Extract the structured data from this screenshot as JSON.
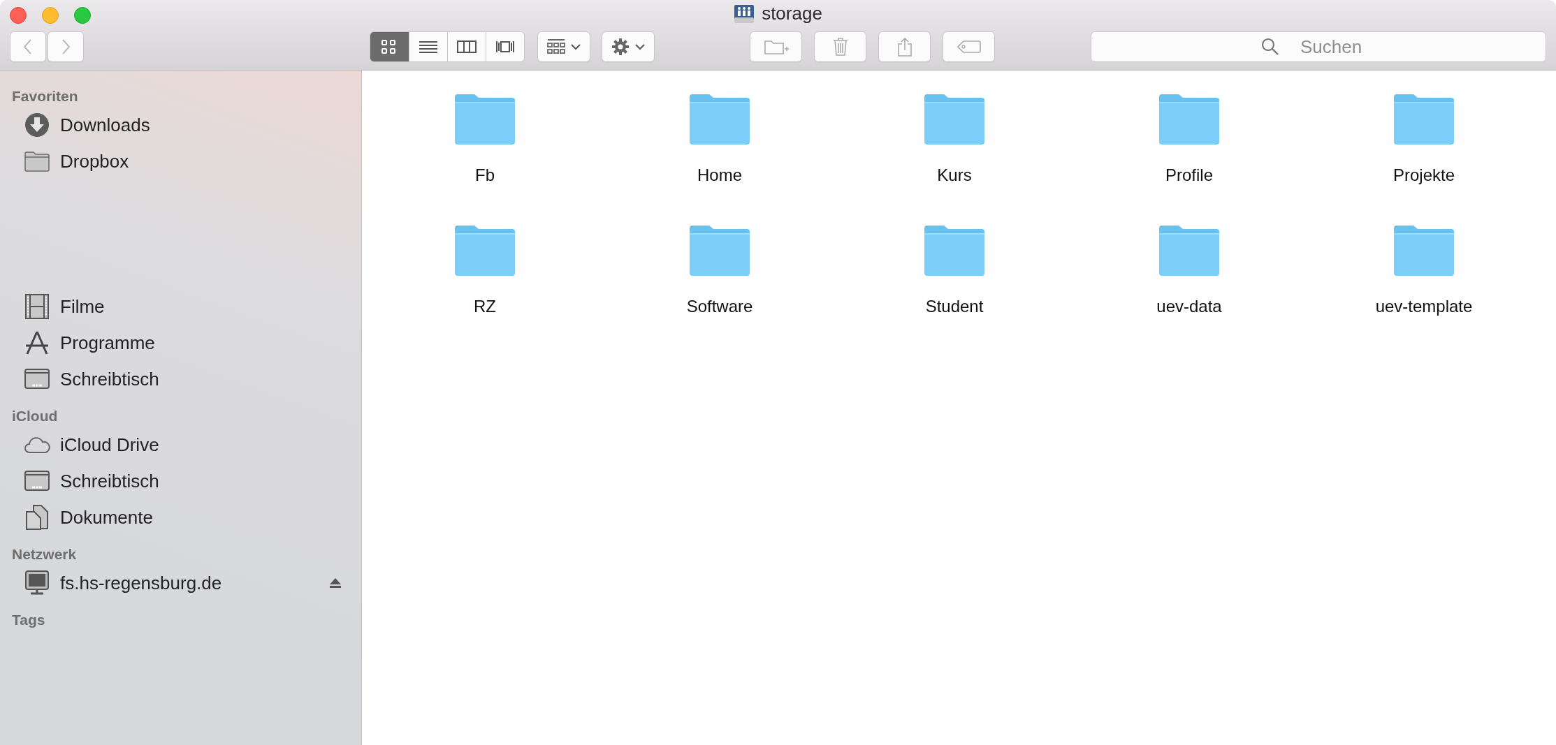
{
  "window": {
    "title": "storage"
  },
  "toolbar": {
    "view_modes": [
      {
        "kind": "icons",
        "selected": true
      },
      {
        "kind": "list",
        "selected": false
      },
      {
        "kind": "columns",
        "selected": false
      },
      {
        "kind": "coverflow",
        "selected": false
      }
    ],
    "search": {
      "placeholder": "Suchen"
    }
  },
  "sidebar": {
    "sections": [
      {
        "title": "Favoriten",
        "items": [
          {
            "label": "Downloads",
            "kind": "downloads"
          },
          {
            "label": "Dropbox",
            "kind": "folder"
          },
          {
            "label": "Filme",
            "kind": "movies"
          },
          {
            "label": "Programme",
            "kind": "apps"
          },
          {
            "label": "Schreibtisch",
            "kind": "desktop"
          }
        ]
      },
      {
        "title": "iCloud",
        "items": [
          {
            "label": "iCloud Drive",
            "kind": "cloud"
          },
          {
            "label": "Schreibtisch",
            "kind": "desktop"
          },
          {
            "label": "Dokumente",
            "kind": "documents"
          }
        ]
      },
      {
        "title": "Netzwerk",
        "items": [
          {
            "label": "fs.hs-regensburg.de",
            "kind": "server",
            "ejectable": true
          }
        ]
      },
      {
        "title": "Tags"
      }
    ]
  },
  "folders": [
    {
      "name": "Fb"
    },
    {
      "name": "Home"
    },
    {
      "name": "Kurs"
    },
    {
      "name": "Profile"
    },
    {
      "name": "Projekte"
    },
    {
      "name": "RZ"
    },
    {
      "name": "Software"
    },
    {
      "name": "Student"
    },
    {
      "name": "uev-data"
    },
    {
      "name": "uev-template"
    }
  ]
}
